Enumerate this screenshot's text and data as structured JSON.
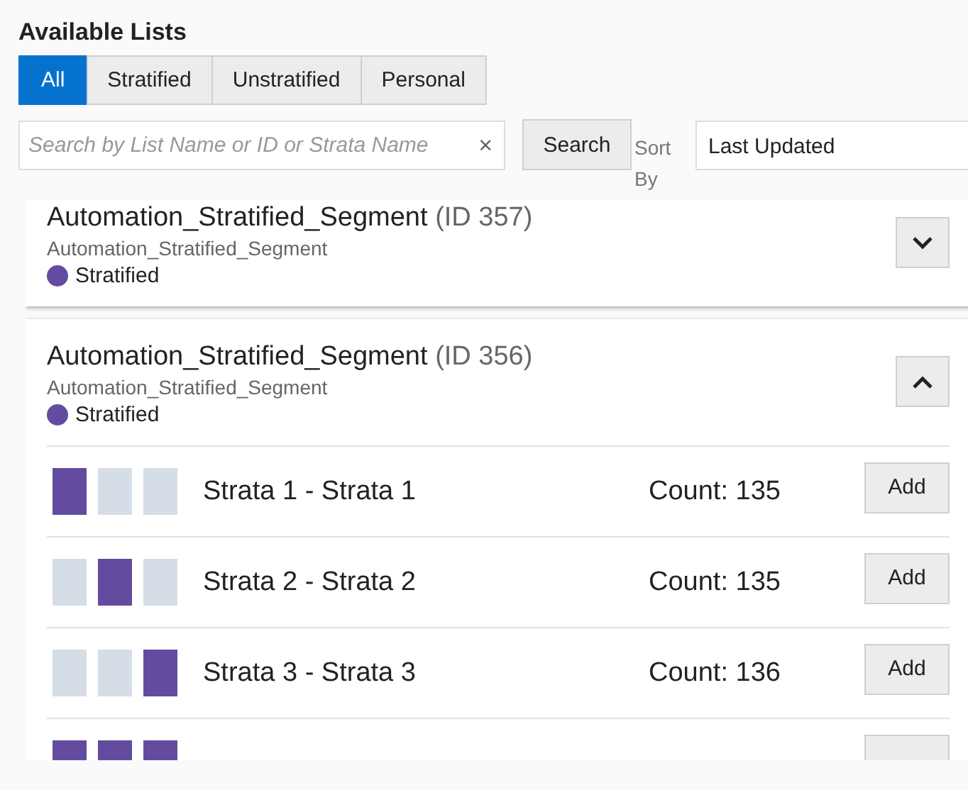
{
  "heading": "Available Lists",
  "tabs": [
    {
      "label": "All",
      "selected": true
    },
    {
      "label": "Stratified",
      "selected": false
    },
    {
      "label": "Unstratified",
      "selected": false
    },
    {
      "label": "Personal",
      "selected": false
    }
  ],
  "search": {
    "placeholder": "Search by List Name or ID or Strata Name",
    "clear": "×",
    "button": "Search"
  },
  "sort": {
    "label": "Sort By",
    "value": "Last Updated"
  },
  "lists": [
    {
      "title": "Automation_Stratified_Segment",
      "id_text": "(ID 357)",
      "subtitle": "Automation_Stratified_Segment",
      "type_label": "Stratified",
      "color": "#634c9f",
      "expanded": false
    },
    {
      "title": "Automation_Stratified_Segment",
      "id_text": "(ID 356)",
      "subtitle": "Automation_Stratified_Segment",
      "type_label": "Stratified",
      "color": "#634c9f",
      "expanded": true,
      "strata": [
        {
          "kind": "full",
          "segments": [
            {
              "filled": true
            },
            {
              "filled": false
            },
            {
              "filled": false
            }
          ],
          "label": "Strata 1 - Strata 1",
          "count": "Count: 135",
          "button": "Add"
        },
        {
          "kind": "full",
          "segments": [
            {
              "filled": false
            },
            {
              "filled": true
            },
            {
              "filled": false
            }
          ],
          "label": "Strata 2 - Strata 2",
          "count": "Count: 135",
          "button": "Add"
        },
        {
          "kind": "full",
          "segments": [
            {
              "filled": false
            },
            {
              "filled": false
            },
            {
              "filled": true
            }
          ],
          "label": "Strata 3 - Strata 3",
          "count": "Count: 136",
          "button": "Add"
        },
        {
          "kind": "partial",
          "segments": [
            {
              "filled": true
            },
            {
              "filled": true
            },
            {
              "filled": true
            }
          ]
        }
      ]
    }
  ]
}
